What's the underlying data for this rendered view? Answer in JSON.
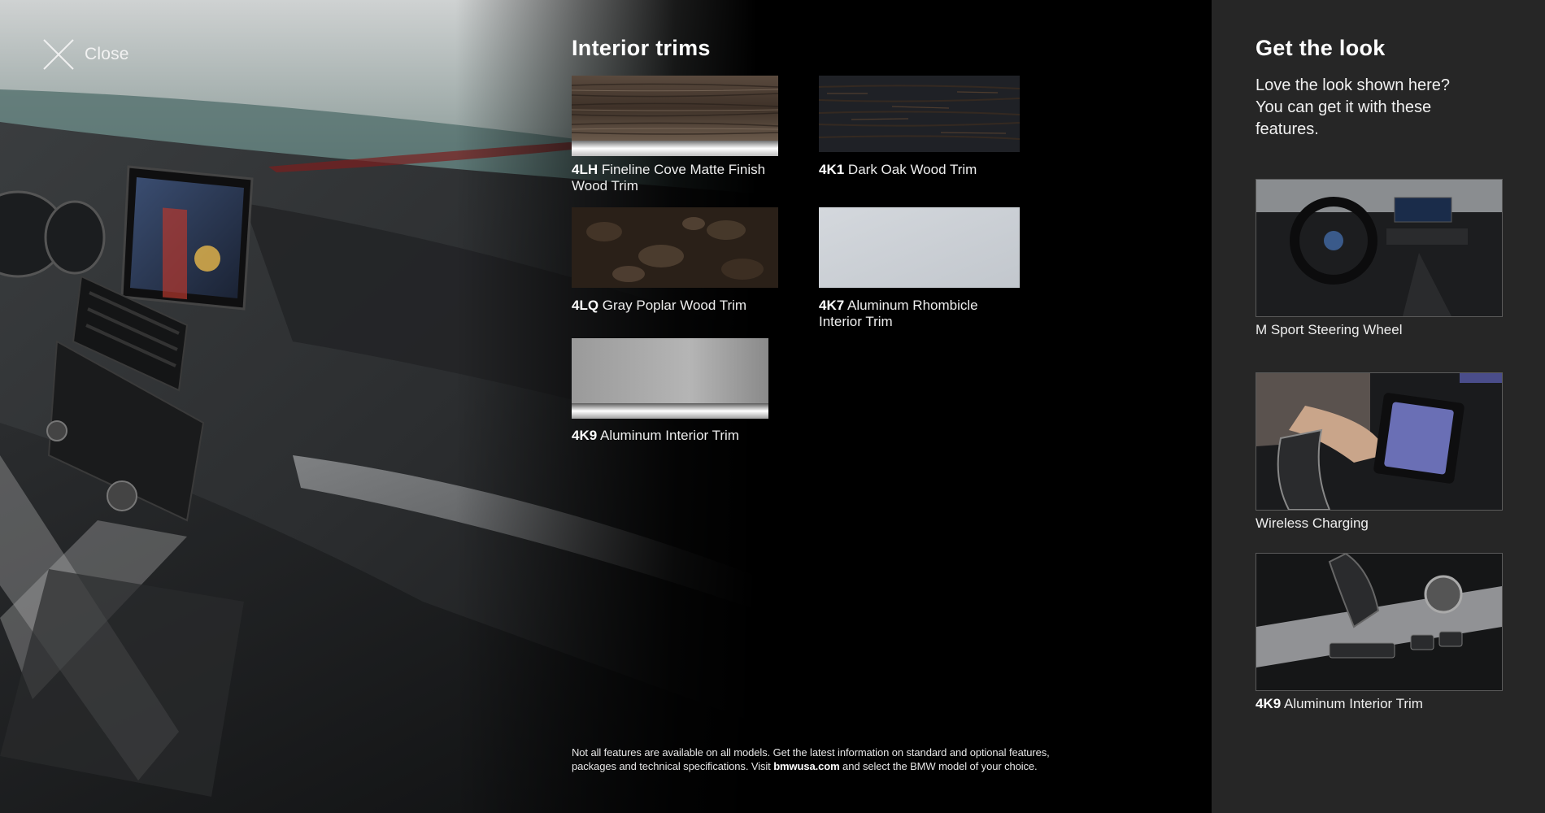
{
  "close": {
    "label": "Close"
  },
  "trims": {
    "title": "Interior trims",
    "items": [
      {
        "code": "4LH",
        "name": "Fineline Cove Matte Finish Wood Trim"
      },
      {
        "code": "4K1",
        "name": "Dark Oak Wood Trim"
      },
      {
        "code": "4LQ",
        "name": "Gray Poplar Wood Trim"
      },
      {
        "code": "4K7",
        "name": "Aluminum Rhombicle Interior Trim"
      },
      {
        "code": "4K9",
        "name": "Aluminum Interior Trim"
      }
    ]
  },
  "disclaimer": {
    "line_pre": "Not all features are available on all models. Get the latest information on standard and optional features, packages and technical specifications. Visit ",
    "link": "bmwusa.com",
    "line_post": " and select the BMW model of your choice."
  },
  "get_the_look": {
    "title": "Get the look",
    "intro": "Love the look shown here? You can get it with these features.",
    "features": [
      {
        "code": "",
        "name": "M Sport Steering Wheel"
      },
      {
        "code": "",
        "name": "Wireless Charging"
      },
      {
        "code": "4K9",
        "name": "Aluminum Interior Trim"
      }
    ]
  },
  "colors": {
    "background": "#000000",
    "sidebar": "#262626",
    "text": "#ffffff"
  }
}
